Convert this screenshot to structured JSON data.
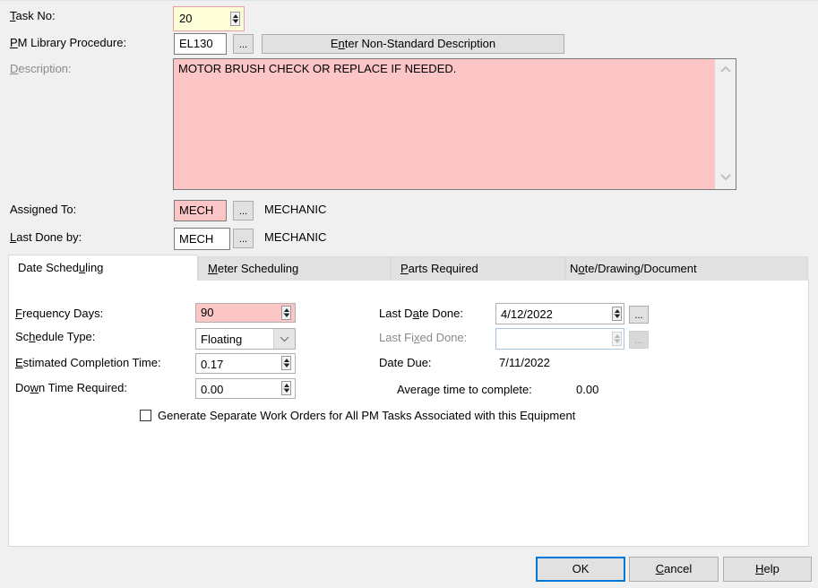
{
  "form": {
    "task_no": {
      "label_u": "T",
      "label_rest": "ask No:",
      "value": "20"
    },
    "pm_library": {
      "label_u": "P",
      "label_rest": "M Library Procedure:",
      "value": "EL130",
      "browse_label": "...",
      "nonstandard_button": {
        "pre": "E",
        "u": "n",
        "post": "ter Non-Standard Description"
      }
    },
    "description": {
      "label_u": "D",
      "label_rest": "escription:",
      "value": "MOTOR BRUSH CHECK OR REPLACE IF NEEDED."
    },
    "assigned_to": {
      "label": "Assigned To:",
      "value": "MECH",
      "browse_label": "...",
      "name": "MECHANIC"
    },
    "last_done_by": {
      "label_u": "L",
      "label_rest": "ast Done by:",
      "value": "MECH",
      "browse_label": "...",
      "name": "MECHANIC"
    }
  },
  "tabs": [
    {
      "pre": "Date Sched",
      "u": "u",
      "post": "ling",
      "active": true
    },
    {
      "pre": "",
      "u": "M",
      "post": "eter Scheduling",
      "active": false
    },
    {
      "pre": "",
      "u": "P",
      "post": "arts Required",
      "active": false
    },
    {
      "pre": "N",
      "u": "o",
      "post": "te/Drawing/Document",
      "active": false
    }
  ],
  "date_scheduling": {
    "frequency_days": {
      "label_u": "F",
      "label_rest": "requency Days:",
      "value": "90"
    },
    "schedule_type": {
      "label_pre": "Sc",
      "label_u": "h",
      "label_rest": "edule Type:",
      "value": "Floating"
    },
    "estimated_completion": {
      "label_u": "E",
      "label_rest": "stimated Completion Time:",
      "value": "0.17"
    },
    "down_time": {
      "label_pre": "Do",
      "label_u": "w",
      "label_rest": "n Time Required:",
      "value": "0.00"
    },
    "last_date_done": {
      "label_pre": "Last D",
      "label_u": "a",
      "label_rest": "te Done:",
      "value": "4/12/2022",
      "browse_label": "..."
    },
    "last_fixed_done": {
      "label_pre": "Last Fi",
      "label_u": "x",
      "label_rest": "ed Done:",
      "value": "",
      "browse_label": "..."
    },
    "date_due": {
      "label": "Date Due:",
      "value": "7/11/2022"
    },
    "average_time": {
      "label": "Average time to complete:",
      "value": "0.00"
    },
    "generate_separate": {
      "label": "Generate Separate Work Orders for All PM Tasks Associated with this Equipment",
      "checked": false
    }
  },
  "buttons": {
    "ok": {
      "pre": "OK",
      "u": "",
      "post": ""
    },
    "cancel": {
      "pre": "",
      "u": "C",
      "post": "ancel"
    },
    "help": {
      "pre": "",
      "u": "H",
      "post": "elp"
    }
  },
  "colors": {
    "required_field": "#fcc6c6",
    "focused_field": "#fdfdd8",
    "accent": "#0078d7"
  }
}
